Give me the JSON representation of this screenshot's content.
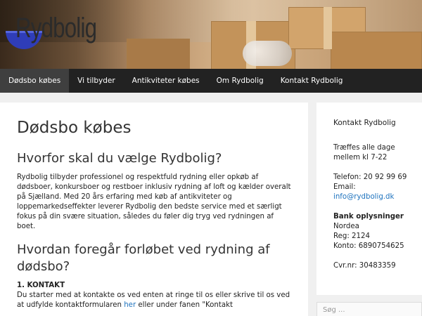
{
  "site": {
    "logo_text": "Rydbolig"
  },
  "nav": {
    "items": [
      {
        "label": "Dødsbo købes"
      },
      {
        "label": "Vi tilbyder"
      },
      {
        "label": "Antikviteter købes"
      },
      {
        "label": "Om Rydbolig"
      },
      {
        "label": "Kontakt Rydbolig"
      }
    ]
  },
  "main": {
    "title": "Dødsbo købes",
    "heading1": "Hvorfor skal du vælge Rydbolig?",
    "paragraph1": "Rydbolig tilbyder professionel og respektfuld rydning eller opkøb af dødsboer, konkursboer og restboer inklusiv rydning af loft og kælder overalt på Sjælland. Med 20 års erfaring med køb af antikviteter og loppemarkedseffekter leverer Rydbolig den bedste service med et særligt fokus på din svære situation, således du føler dig tryg ved rydningen af boet.",
    "heading2": "Hvordan foregår forløbet ved rydning af dødsbo?",
    "step1_title": "1. KONTAKT",
    "step1_text_a": "Du starter med at kontakte os ved enten at ringe til os eller skrive til os ved at udfylde kontaktformularen ",
    "step1_link": "her",
    "step1_text_b": " eller under fanen \"Kontakt"
  },
  "sidebar": {
    "title": "Kontakt Rydbolig",
    "hours_line1": "Træffes alle dage",
    "hours_line2": "mellem kl 7-22",
    "phone": "Telefon: 20 92 99 69",
    "email_label": "Email:",
    "email": "info@rydbolig.dk",
    "bank_title": "Bank oplysninger",
    "bank_name": "Nordea",
    "reg": "Reg: 2124",
    "konto": "Konto: 6890754625",
    "cvr": "Cvr.nr: 30483359"
  },
  "search": {
    "placeholder": "Søg ..."
  },
  "colors": {
    "nav_bg": "#222222",
    "nav_active": "#3f3f3f",
    "link": "#1e73be"
  }
}
